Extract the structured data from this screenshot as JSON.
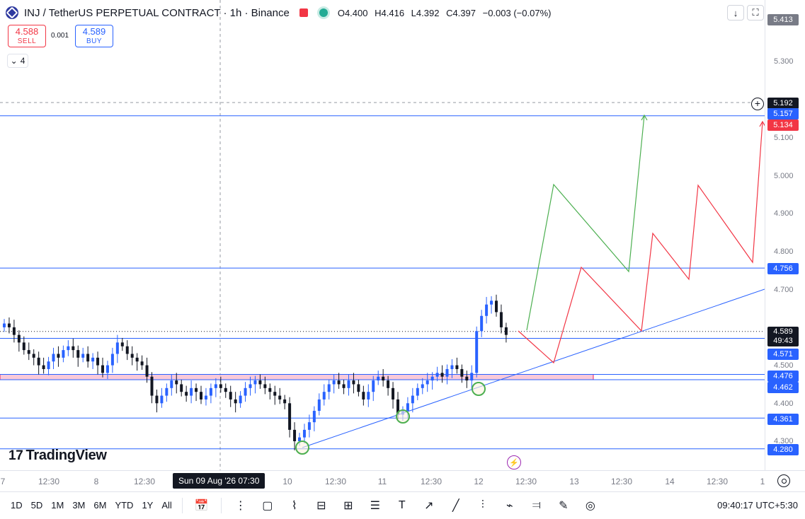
{
  "header": {
    "title": "INJ / TetherUS PERPETUAL CONTRACT · 1h · Binance",
    "ohlc": {
      "open": "O4.400",
      "high": "H4.416",
      "low": "L4.392",
      "close": "C4.397",
      "change": "−0.003 (−0.07%)"
    }
  },
  "trade": {
    "sell_price": "4.588",
    "sell_label": "SELL",
    "buy_price": "4.589",
    "buy_label": "BUY",
    "spread": "0.001"
  },
  "indicators_count": "4",
  "brand": "TradingView",
  "price_scale": {
    "ticks": [
      "5.300",
      "5.100",
      "5.000",
      "4.900",
      "4.800",
      "4.700",
      "4.500",
      "4.400",
      "4.300"
    ],
    "top_label": "5.413",
    "crosshair": "5.192",
    "labels": {
      "l5157": "5.157",
      "l5134": "5.134",
      "l4756": "4.756",
      "last_price": "4.589",
      "countdown": "49:43",
      "l4571": "4.571",
      "l4476": "4.476",
      "l4462": "4.462",
      "l4361": "4.361",
      "l4280": "4.280"
    }
  },
  "time_scale": {
    "ticks": [
      "7",
      "12:30",
      "8",
      "12:30",
      "10",
      "12:30",
      "11",
      "12:30",
      "12",
      "12:30",
      "13",
      "12:30",
      "14",
      "12:30",
      "1"
    ],
    "crosshair": "Sun 09 Aug '26   07:30"
  },
  "toolbar": {
    "ranges": [
      "1D",
      "5D",
      "1M",
      "3M",
      "6M",
      "YTD",
      "1Y",
      "All"
    ],
    "clock": "09:40:17 UTC+5:30"
  },
  "colors": {
    "blue": "#2962ff",
    "red": "#f23645",
    "green": "#4caf50",
    "candle_up": "#2962ff",
    "candle_down": "#131722",
    "zone": "#f8bbd0"
  },
  "chart_data": {
    "type": "candlestick",
    "symbol": "INJ / TetherUS PERPETUAL CONTRACT",
    "interval": "1h",
    "exchange": "Binance",
    "ylim": [
      4.25,
      5.42
    ],
    "horizontal_levels": [
      5.157,
      4.756,
      4.571,
      4.476,
      4.462,
      4.361,
      4.28
    ],
    "last_price": 4.589,
    "closes": [
      4.61,
      4.6,
      4.58,
      4.56,
      4.54,
      4.53,
      4.52,
      4.5,
      4.49,
      4.51,
      4.53,
      4.52,
      4.54,
      4.55,
      4.54,
      4.52,
      4.53,
      4.51,
      4.52,
      4.5,
      4.48,
      4.5,
      4.53,
      4.56,
      4.55,
      4.53,
      4.52,
      4.51,
      4.5,
      4.47,
      4.42,
      4.4,
      4.42,
      4.44,
      4.46,
      4.45,
      4.43,
      4.42,
      4.44,
      4.43,
      4.41,
      4.42,
      4.44,
      4.45,
      4.44,
      4.43,
      4.41,
      4.4,
      4.42,
      4.44,
      4.45,
      4.46,
      4.45,
      4.44,
      4.43,
      4.42,
      4.41,
      4.4,
      4.33,
      4.3,
      4.31,
      4.33,
      4.35,
      4.38,
      4.41,
      4.43,
      4.45,
      4.46,
      4.45,
      4.44,
      4.46,
      4.45,
      4.43,
      4.41,
      4.43,
      4.46,
      4.47,
      4.46,
      4.44,
      4.41,
      4.37,
      4.38,
      4.4,
      4.42,
      4.44,
      4.45,
      4.46,
      4.47,
      4.48,
      4.47,
      4.49,
      4.5,
      4.49,
      4.47,
      4.46,
      4.48,
      4.59,
      4.63,
      4.66,
      4.67,
      4.64,
      4.6,
      4.58
    ],
    "drawings": {
      "green_path": [
        [
          744,
          467
        ],
        [
          782,
          261
        ],
        [
          888,
          384
        ],
        [
          910,
          163
        ]
      ],
      "red_path": [
        [
          732,
          468
        ],
        [
          782,
          513
        ],
        [
          821,
          378
        ],
        [
          906,
          468
        ],
        [
          922,
          330
        ],
        [
          973,
          395
        ],
        [
          986,
          262
        ],
        [
          1063,
          371
        ],
        [
          1077,
          172
        ]
      ],
      "trendline": [
        [
          427,
          633
        ],
        [
          1080,
          409
        ]
      ]
    }
  }
}
